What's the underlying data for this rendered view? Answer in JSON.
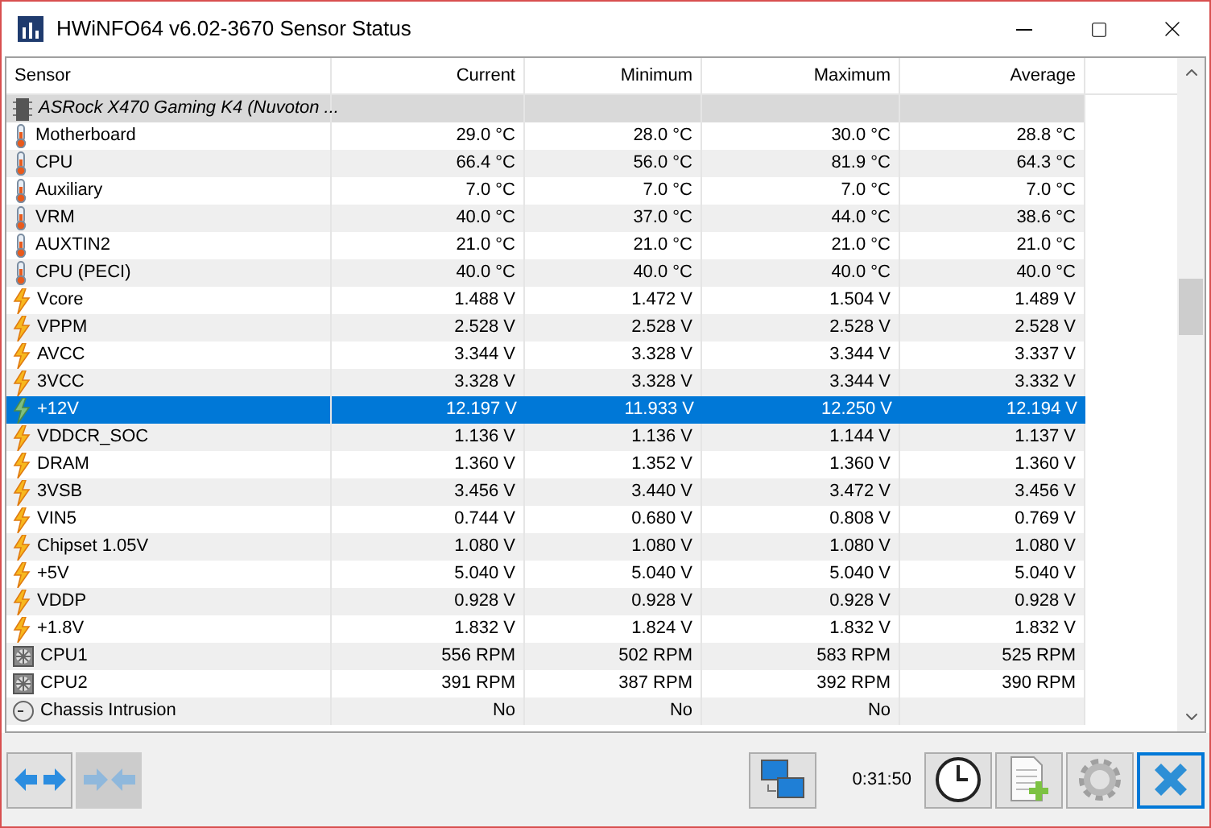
{
  "window": {
    "title": "HWiNFO64 v6.02-3670 Sensor Status"
  },
  "table": {
    "columns": [
      "Sensor",
      "Current",
      "Minimum",
      "Maximum",
      "Average"
    ],
    "rows": [
      {
        "kind": "group",
        "name": "ASRock X470 Gaming K4 (Nuvoton ...",
        "selected": false
      },
      {
        "kind": "temperature",
        "name": "Motherboard",
        "values": [
          "29.0 °C",
          "28.0 °C",
          "30.0 °C",
          "28.8 °C"
        ],
        "selected": false
      },
      {
        "kind": "temperature",
        "name": "CPU",
        "values": [
          "66.4 °C",
          "56.0 °C",
          "81.9 °C",
          "64.3 °C"
        ],
        "selected": false
      },
      {
        "kind": "temperature",
        "name": "Auxiliary",
        "values": [
          "7.0 °C",
          "7.0 °C",
          "7.0 °C",
          "7.0 °C"
        ],
        "selected": false
      },
      {
        "kind": "temperature",
        "name": "VRM",
        "values": [
          "40.0 °C",
          "37.0 °C",
          "44.0 °C",
          "38.6 °C"
        ],
        "selected": false
      },
      {
        "kind": "temperature",
        "name": "AUXTIN2",
        "values": [
          "21.0 °C",
          "21.0 °C",
          "21.0 °C",
          "21.0 °C"
        ],
        "selected": false
      },
      {
        "kind": "temperature",
        "name": "CPU (PECI)",
        "values": [
          "40.0 °C",
          "40.0 °C",
          "40.0 °C",
          "40.0 °C"
        ],
        "selected": false
      },
      {
        "kind": "voltage",
        "name": "Vcore",
        "values": [
          "1.488 V",
          "1.472 V",
          "1.504 V",
          "1.489 V"
        ],
        "selected": false
      },
      {
        "kind": "voltage",
        "name": "VPPM",
        "values": [
          "2.528 V",
          "2.528 V",
          "2.528 V",
          "2.528 V"
        ],
        "selected": false
      },
      {
        "kind": "voltage",
        "name": "AVCC",
        "values": [
          "3.344 V",
          "3.328 V",
          "3.344 V",
          "3.337 V"
        ],
        "selected": false
      },
      {
        "kind": "voltage",
        "name": "3VCC",
        "values": [
          "3.328 V",
          "3.328 V",
          "3.344 V",
          "3.332 V"
        ],
        "selected": false
      },
      {
        "kind": "voltage",
        "name": "+12V",
        "values": [
          "12.197 V",
          "11.933 V",
          "12.250 V",
          "12.194 V"
        ],
        "selected": true
      },
      {
        "kind": "voltage",
        "name": "VDDCR_SOC",
        "values": [
          "1.136 V",
          "1.136 V",
          "1.144 V",
          "1.137 V"
        ],
        "selected": false
      },
      {
        "kind": "voltage",
        "name": "DRAM",
        "values": [
          "1.360 V",
          "1.352 V",
          "1.360 V",
          "1.360 V"
        ],
        "selected": false
      },
      {
        "kind": "voltage",
        "name": "3VSB",
        "values": [
          "3.456 V",
          "3.440 V",
          "3.472 V",
          "3.456 V"
        ],
        "selected": false
      },
      {
        "kind": "voltage",
        "name": "VIN5",
        "values": [
          "0.744 V",
          "0.680 V",
          "0.808 V",
          "0.769 V"
        ],
        "selected": false
      },
      {
        "kind": "voltage",
        "name": "Chipset 1.05V",
        "values": [
          "1.080 V",
          "1.080 V",
          "1.080 V",
          "1.080 V"
        ],
        "selected": false
      },
      {
        "kind": "voltage",
        "name": "+5V",
        "values": [
          "5.040 V",
          "5.040 V",
          "5.040 V",
          "5.040 V"
        ],
        "selected": false
      },
      {
        "kind": "voltage",
        "name": "VDDP",
        "values": [
          "0.928 V",
          "0.928 V",
          "0.928 V",
          "0.928 V"
        ],
        "selected": false
      },
      {
        "kind": "voltage",
        "name": "+1.8V",
        "values": [
          "1.832 V",
          "1.824 V",
          "1.832 V",
          "1.832 V"
        ],
        "selected": false
      },
      {
        "kind": "fan",
        "name": "CPU1",
        "values": [
          "556 RPM",
          "502 RPM",
          "583 RPM",
          "525 RPM"
        ],
        "selected": false
      },
      {
        "kind": "fan",
        "name": "CPU2",
        "values": [
          "391 RPM",
          "387 RPM",
          "392 RPM",
          "390 RPM"
        ],
        "selected": false
      },
      {
        "kind": "intrusion",
        "name": "Chassis Intrusion",
        "values": [
          "No",
          "No",
          "No"
        ],
        "selected": false
      }
    ]
  },
  "status_bar": {
    "timer": "0:31:50"
  }
}
